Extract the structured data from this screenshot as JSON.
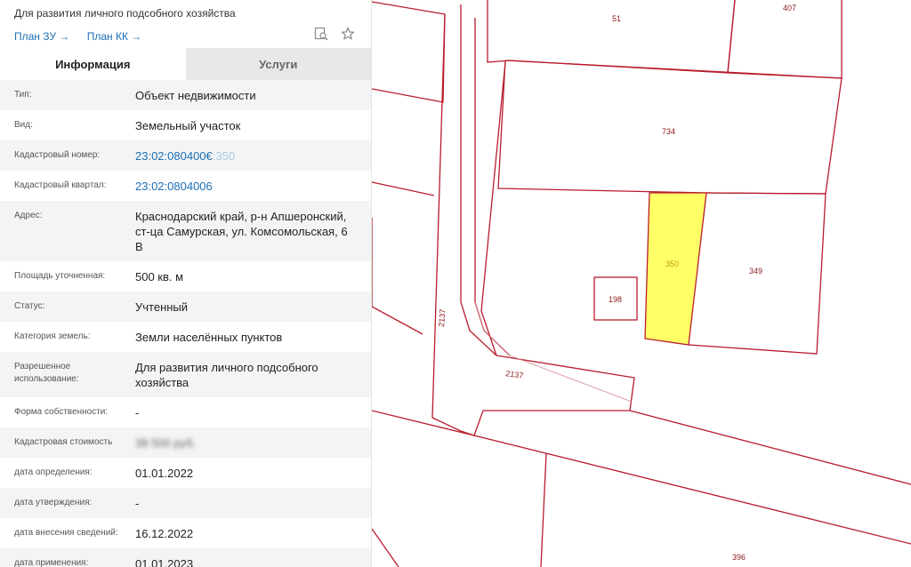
{
  "header": {
    "title": "Для развития личного подсобного хозяйства",
    "links": [
      {
        "label": "План ЗУ",
        "arrow": "→"
      },
      {
        "label": "План КК",
        "arrow": "→"
      }
    ],
    "icons": [
      "search-doc-icon",
      "star-icon"
    ]
  },
  "tabs": [
    {
      "label": "Информация",
      "active": true
    },
    {
      "label": "Услуги",
      "active": false
    }
  ],
  "rows": [
    {
      "label": "Тип:",
      "value": "Объект недвижимости"
    },
    {
      "label": "Вид:",
      "value": "Земельный участок"
    },
    {
      "label": "Кадастровый номер:",
      "value_main": "23:02:080400€",
      "value_fade": ":350"
    },
    {
      "label": "Кадастровый квартал:",
      "value": "23:02:0804006"
    },
    {
      "label": "Адрес:",
      "value": "Краснодарский край, р-н Апшеронский, ст-ца Самурская, ул. Комсомольская, 6 В"
    },
    {
      "label": "Площадь уточненная:",
      "value": "500 кв. м"
    },
    {
      "label": "Статус:",
      "value": "Учтенный"
    },
    {
      "label": "Категория земель:",
      "value": "Земли населённых пунктов"
    },
    {
      "label": "Разрешенное использование:",
      "value": "Для развития личного подсобного хозяйства"
    },
    {
      "label": "Форма собственности:",
      "value": "-"
    },
    {
      "label": "Кадастровая стоимость",
      "value": "38 500 руб."
    },
    {
      "label": "дата определения:",
      "value": "01.01.2022"
    },
    {
      "label": "дата утверждения:",
      "value": "-"
    },
    {
      "label": "дата внесения сведений:",
      "value": "16.12.2022"
    },
    {
      "label": "дата применения:",
      "value": "01.01.2023"
    }
  ],
  "map": {
    "parcel_labels": [
      "51",
      "407",
      "734",
      "350",
      "349",
      "198",
      "2137",
      "2137",
      "396"
    ],
    "colors": {
      "boundary": "#b81c2c",
      "selected_fill": "#ffff66",
      "label": "#8b1a1a"
    }
  }
}
